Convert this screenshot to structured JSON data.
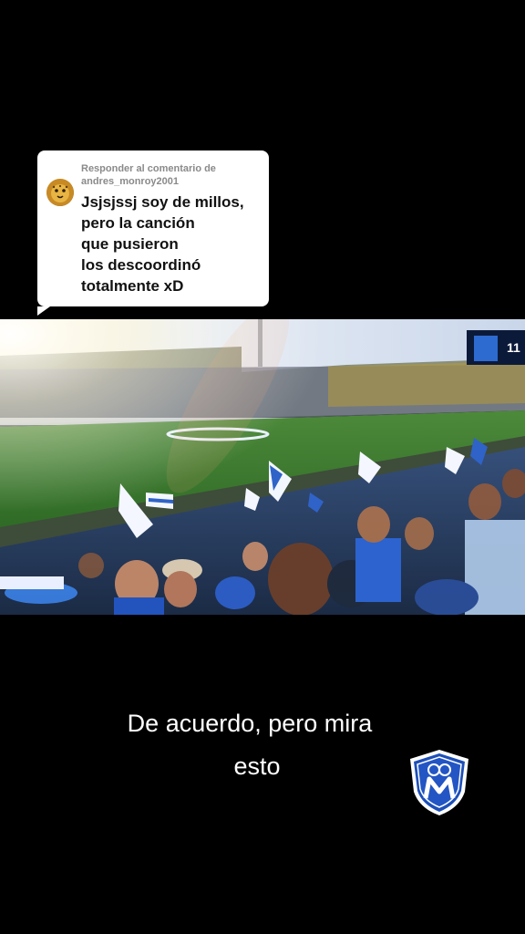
{
  "reply_card": {
    "header_line1": "Responder al comentario de",
    "header_line2": "andres_monroy2001",
    "comment_lines": [
      "Jsjsjssj soy de millos,",
      "pero la canción",
      "que pusieron",
      "los descoordinó",
      "totalmente xD"
    ]
  },
  "video": {
    "scoreboard_number": "11"
  },
  "caption": {
    "line1": "De acuerdo, pero mira",
    "line2": "esto"
  },
  "colors": {
    "background": "#000000",
    "card": "#ffffff",
    "brand_blue": "#1d4fb8",
    "caption_text": "#ffffff"
  },
  "icons": {
    "avatar": "jaguar-avatar-icon",
    "crest": "millonarios-crest-icon"
  }
}
